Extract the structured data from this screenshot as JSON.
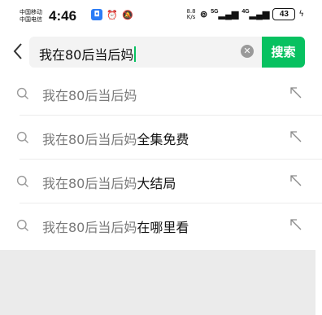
{
  "status_bar": {
    "carrier_1": "中国移动",
    "carrier_2": "中国电信",
    "time": "4:46",
    "net_speed_value": "8.8",
    "net_speed_unit": "K/s",
    "signal_1": "5G",
    "signal_2": "4G",
    "battery": "43",
    "icons": [
      "app-notification-icon",
      "alarm-icon",
      "mute-icon",
      "hotspot-icon",
      "signal-icon",
      "charging-icon"
    ]
  },
  "search": {
    "query": "我在80后当后妈",
    "button_label": "搜索"
  },
  "suggestions": [
    {
      "prefix": "我在80后当后妈",
      "suffix": ""
    },
    {
      "prefix": "我在80后当后妈",
      "suffix": "全集免费"
    },
    {
      "prefix": "我在80后当后妈",
      "suffix": "大结局"
    },
    {
      "prefix": "我在80后当后妈",
      "suffix": "在哪里看"
    }
  ],
  "colors": {
    "accent": "#07c160",
    "search_bg": "#f3f3f3",
    "footer_bg": "#ebebeb"
  }
}
